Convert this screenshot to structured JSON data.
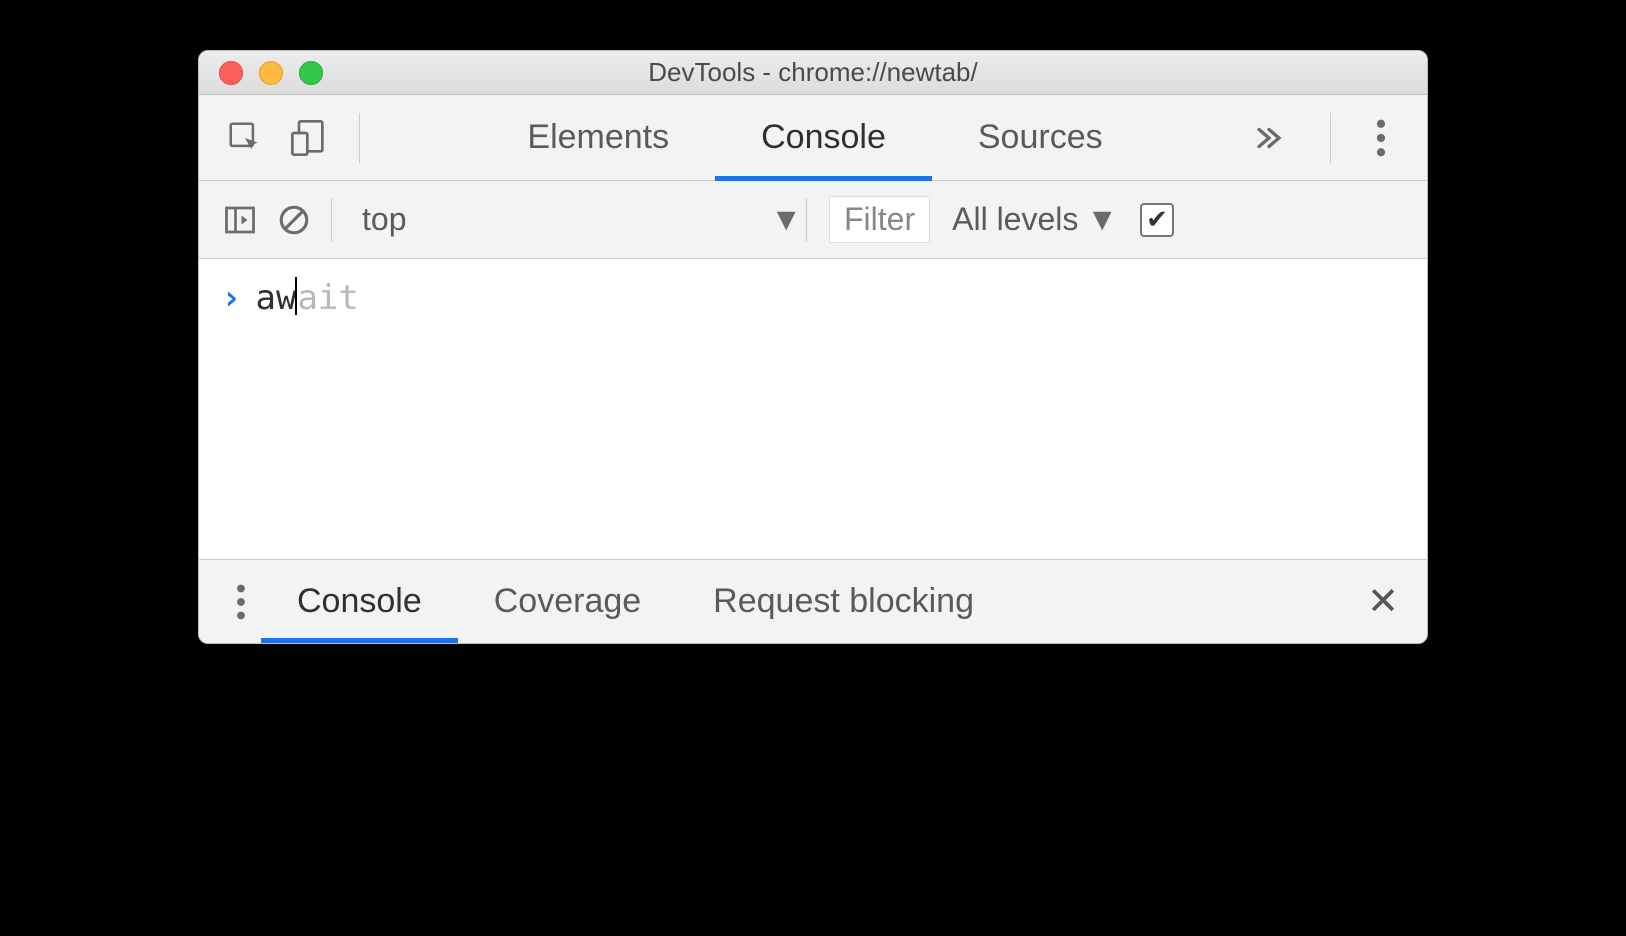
{
  "window": {
    "title": "DevTools - chrome://newtab/"
  },
  "tabs": {
    "items": [
      "Elements",
      "Console",
      "Sources"
    ],
    "active_index": 1
  },
  "console_toolbar": {
    "context": "top",
    "filter_placeholder": "Filter",
    "levels_label": "All levels",
    "hide_checkbox_checked": true
  },
  "console": {
    "typed": "aw",
    "autocomplete_suffix": "ait"
  },
  "drawer": {
    "tabs": [
      "Console",
      "Coverage",
      "Request blocking"
    ],
    "active_index": 0
  }
}
